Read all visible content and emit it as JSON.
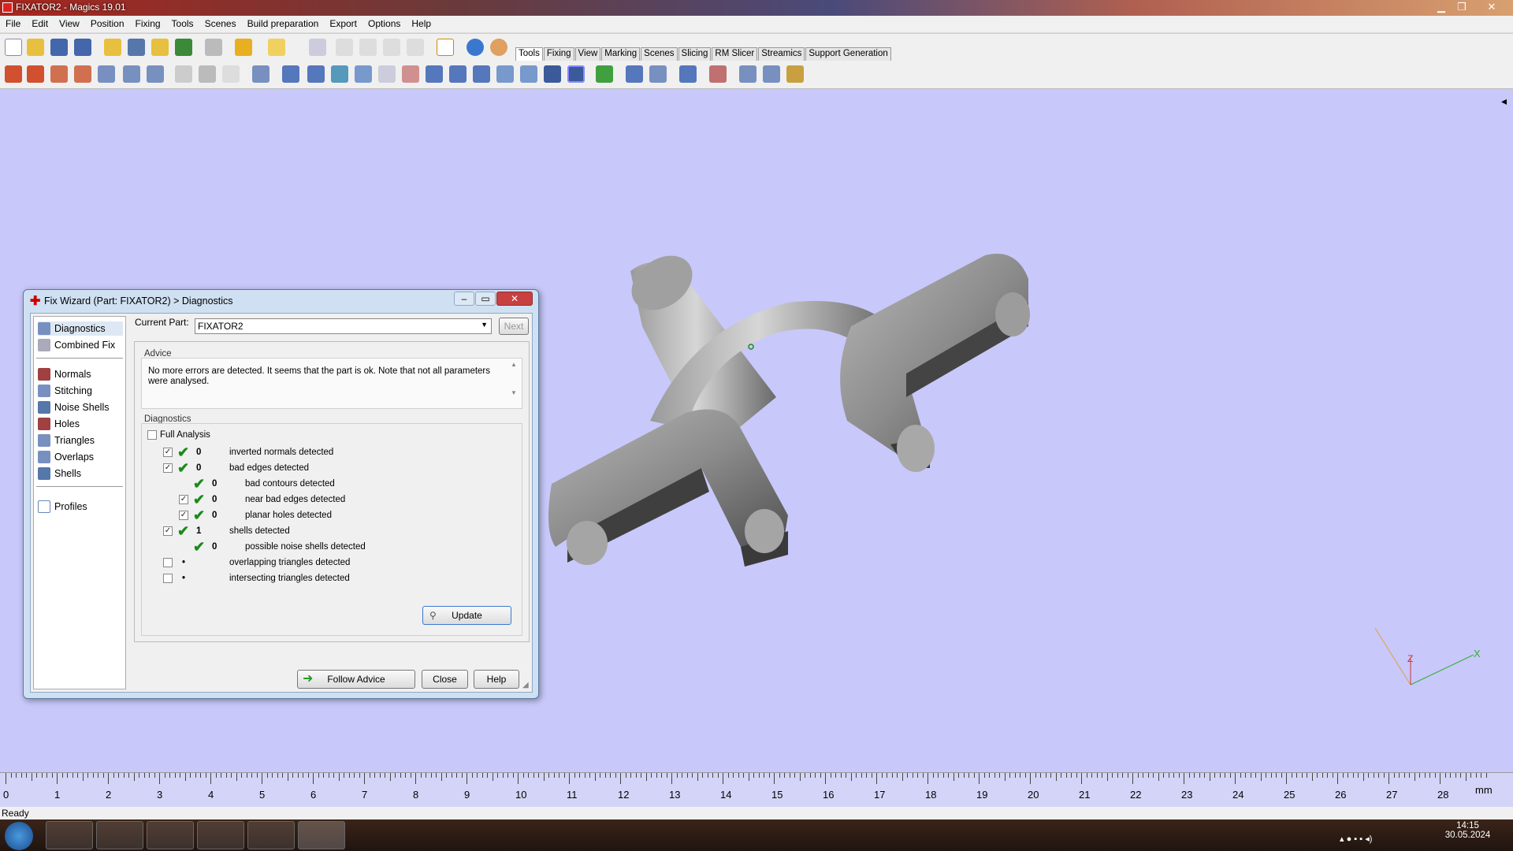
{
  "window": {
    "title": "FIXATOR2 - Magics 19.01"
  },
  "menu": [
    "File",
    "Edit",
    "View",
    "Position",
    "Fixing",
    "Tools",
    "Scenes",
    "Build preparation",
    "Export",
    "Options",
    "Help"
  ],
  "tabs": [
    "Tools",
    "Fixing",
    "View",
    "Marking",
    "Scenes",
    "Slicing",
    "RM Slicer",
    "Streamics",
    "Support Generation"
  ],
  "active_tab": "Tools",
  "dialog": {
    "title": "Fix Wizard (Part: FIXATOR2) > Diagnostics",
    "nav": {
      "group1": [
        "Diagnostics",
        "Combined Fix"
      ],
      "group2": [
        "Normals",
        "Stitching",
        "Noise Shells",
        "Holes",
        "Triangles",
        "Overlaps",
        "Shells"
      ],
      "group3": [
        "Profiles"
      ]
    },
    "current_part_label": "Current Part:",
    "current_part_value": "FIXATOR2",
    "next_label": "Next",
    "advice_title": "Advice",
    "advice_text": "No more errors are detected. It seems that the part is ok. Note that not all parameters were analysed.",
    "diagnostics_title": "Diagnostics",
    "full_analysis_label": "Full Analysis",
    "rows": [
      {
        "checked": true,
        "ok": true,
        "count": "0",
        "label": "inverted normals detected",
        "indent": 0
      },
      {
        "checked": true,
        "ok": true,
        "count": "0",
        "label": "bad edges detected",
        "indent": 0
      },
      {
        "checked": null,
        "ok": true,
        "count": "0",
        "label": "bad contours detected",
        "indent": 1
      },
      {
        "checked": true,
        "ok": true,
        "count": "0",
        "label": "near bad edges detected",
        "indent": 1
      },
      {
        "checked": true,
        "ok": true,
        "count": "0",
        "label": "planar holes detected",
        "indent": 1
      },
      {
        "checked": true,
        "ok": true,
        "count": "1",
        "label": "shells detected",
        "indent": 0
      },
      {
        "checked": null,
        "ok": true,
        "count": "0",
        "label": "possible noise shells detected",
        "indent": 1
      },
      {
        "checked": false,
        "ok": false,
        "count": "•",
        "label": "overlapping triangles detected",
        "indent": 0
      },
      {
        "checked": false,
        "ok": false,
        "count": "•",
        "label": "intersecting triangles detected",
        "indent": 0
      }
    ],
    "update_label": "Update",
    "follow_advice_label": "Follow Advice",
    "close_label": "Close",
    "help_label": "Help"
  },
  "ruler": {
    "labels": [
      "0",
      "1",
      "2",
      "3",
      "4",
      "5",
      "6",
      "7",
      "8",
      "9",
      "10",
      "11",
      "12",
      "13",
      "14",
      "15",
      "16",
      "17",
      "18",
      "19",
      "20",
      "21",
      "22",
      "23",
      "24",
      "25",
      "26",
      "27",
      "28"
    ],
    "unit": "mm"
  },
  "status": "Ready",
  "clock": {
    "time": "14:15",
    "date": "30.05.2024"
  },
  "axis_labels": {
    "x": "X",
    "z": "Z"
  }
}
